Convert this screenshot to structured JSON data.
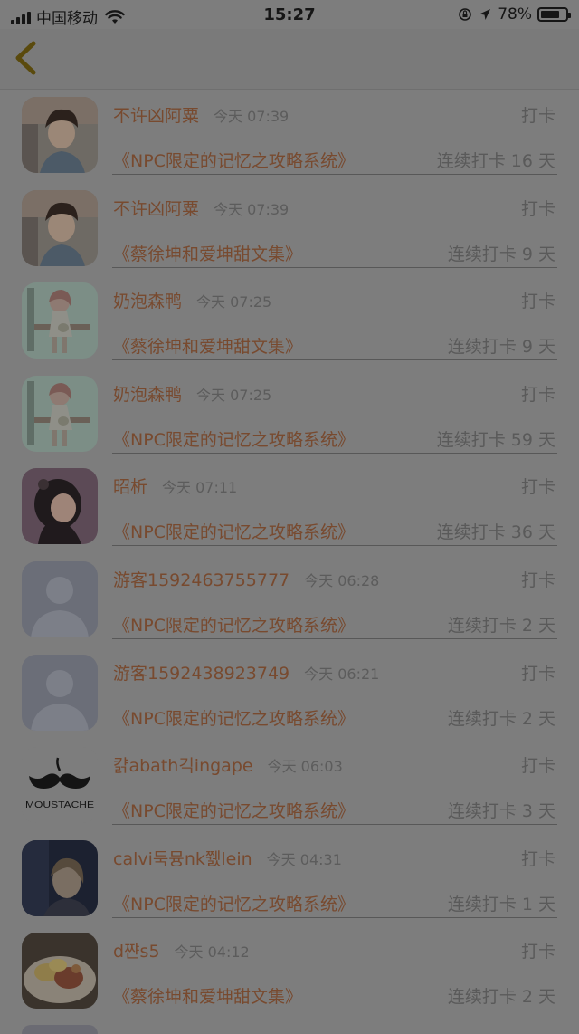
{
  "status_bar": {
    "carrier": "中国移动",
    "time": "15:27",
    "battery": "78%",
    "battery_level": 0.78,
    "icons": [
      "signal-icon",
      "wifi-icon",
      "orientation-lock-icon",
      "location-arrow-icon",
      "battery-icon"
    ]
  },
  "nav": {
    "back_icon": "chevron-left-icon",
    "accent_color": "#5a4a0d"
  },
  "entries": [
    {
      "name": "不许凶阿粟",
      "time": "今天 07:39",
      "action": "打卡",
      "book": "《NPC限定的记忆之攻略系统》",
      "streak": "连续打卡 16 天",
      "avatar": "photo-boy-1"
    },
    {
      "name": "不许凶阿粟",
      "time": "今天 07:39",
      "action": "打卡",
      "book": "《蔡徐坤和爱坤甜文集》",
      "streak": "连续打卡 9 天",
      "avatar": "photo-boy-1"
    },
    {
      "name": "奶泡森鸭",
      "time": "今天 07:25",
      "action": "打卡",
      "book": "《蔡徐坤和爱坤甜文集》",
      "streak": "连续打卡 9 天",
      "avatar": "illustration-girl"
    },
    {
      "name": "奶泡森鸭",
      "time": "今天 07:25",
      "action": "打卡",
      "book": "《NPC限定的记忆之攻略系统》",
      "streak": "连续打卡 59 天",
      "avatar": "illustration-girl"
    },
    {
      "name": "昭析",
      "time": "今天 07:11",
      "action": "打卡",
      "book": "《NPC限定的记忆之攻略系统》",
      "streak": "连续打卡 36 天",
      "avatar": "photo-girl"
    },
    {
      "name": "游客1592463755777",
      "time": "今天 06:28",
      "action": "打卡",
      "book": "《NPC限定的记忆之攻略系统》",
      "streak": "连续打卡 2 天",
      "avatar": "default-user"
    },
    {
      "name": "游客1592438923749",
      "time": "今天 06:21",
      "action": "打卡",
      "book": "《NPC限定的记忆之攻略系统》",
      "streak": "连续打卡 2 天",
      "avatar": "default-user"
    },
    {
      "name": "캵abath긱ingape",
      "time": "今天 06:03",
      "action": "打卡",
      "book": "《NPC限定的记忆之攻略系统》",
      "streak": "连续打卡 3 天",
      "avatar": "moustache",
      "avatar_text": "MOUSTACHE"
    },
    {
      "name": "calvi둑뮹nk쮌lein",
      "time": "今天 04:31",
      "action": "打卡",
      "book": "《NPC限定的记忆之攻略系统》",
      "streak": "连续打卡 1 天",
      "avatar": "photo-dark"
    },
    {
      "name": "d쨘s5",
      "time": "今天 04:12",
      "action": "打卡",
      "book": "《蔡徐坤和爱坤甜文集》",
      "streak": "连续打卡 2 天",
      "avatar": "photo-food"
    }
  ]
}
